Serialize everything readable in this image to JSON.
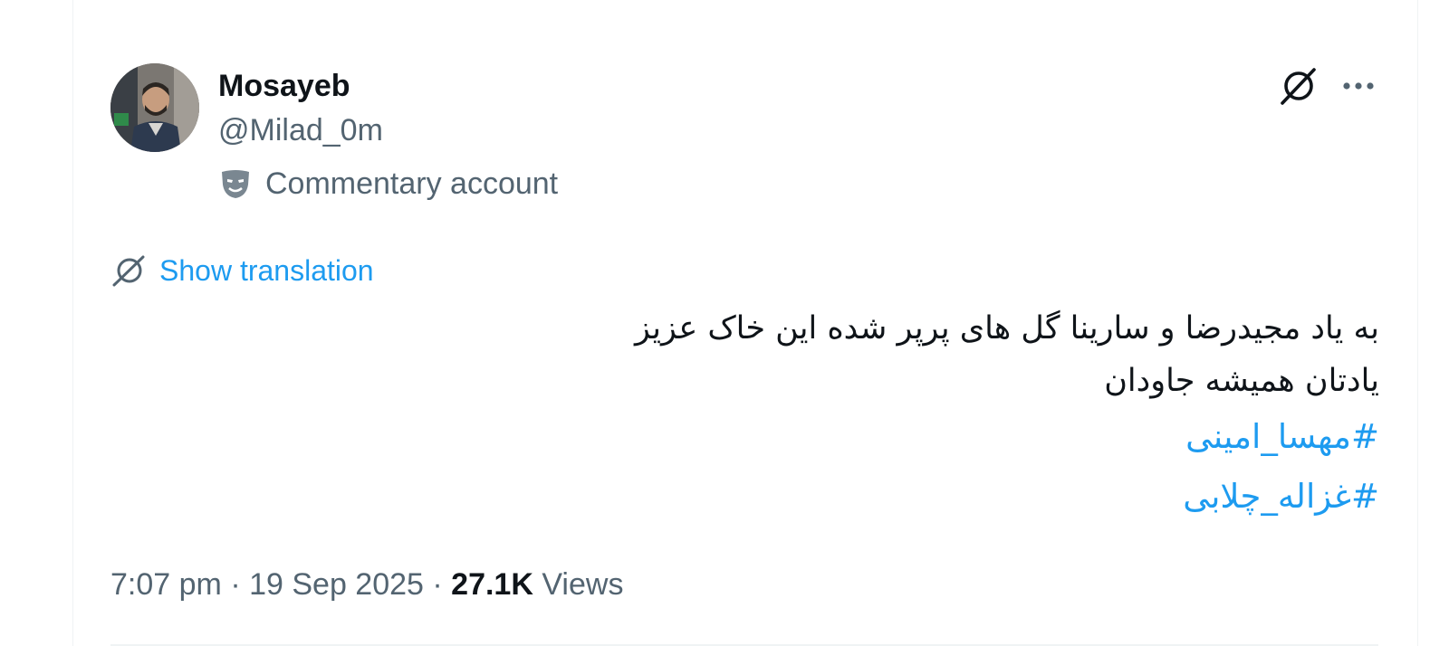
{
  "author": {
    "display_name": "Mosayeb",
    "handle": "@Milad_0m",
    "label": "Commentary account",
    "avatar_icon": "profile-photo"
  },
  "actions": {
    "grok_icon": "grok-slash-icon",
    "more_icon": "more-dots-icon"
  },
  "translation": {
    "label": "Show translation",
    "icon": "grok-slash-icon"
  },
  "tweet": {
    "lines": [
      "به یاد مجیدرضا و سارینا گل های پرپر شده این خاک عزیز",
      "یادتان همیشه جاودان"
    ],
    "hashtags": [
      "#مهسا_امینی",
      "#غزاله_چلابی"
    ]
  },
  "meta": {
    "time": "7:07 pm",
    "separator": "·",
    "date": "19 Sep 2025",
    "views_count": "27.1K",
    "views_label": "Views"
  },
  "colors": {
    "link": "#1d9bf0",
    "text_primary": "#0f1419",
    "text_secondary": "#536471",
    "border": "#eff3f4"
  }
}
